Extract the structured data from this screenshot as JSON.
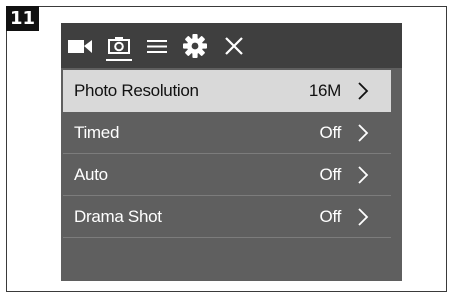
{
  "step_number": "11",
  "tabs": [
    {
      "id": "video",
      "icon": "video-camera-icon"
    },
    {
      "id": "photo",
      "icon": "camera-icon",
      "active": true
    },
    {
      "id": "list",
      "icon": "menu-list-icon"
    },
    {
      "id": "settings",
      "icon": "gear-icon"
    },
    {
      "id": "close",
      "icon": "close-icon"
    }
  ],
  "menu": {
    "items": [
      {
        "label": "Photo Resolution",
        "value": "16M",
        "selected": true
      },
      {
        "label": "Timed",
        "value": "Off",
        "selected": false
      },
      {
        "label": "Auto",
        "value": "Off",
        "selected": false
      },
      {
        "label": "Drama Shot",
        "value": "Off",
        "selected": false
      }
    ]
  },
  "colors": {
    "screen_bg": "#5f5f5f",
    "topbar_bg": "#3f3f3f",
    "selected_row_bg": "#d9d9d9",
    "text": "#ffffff"
  }
}
